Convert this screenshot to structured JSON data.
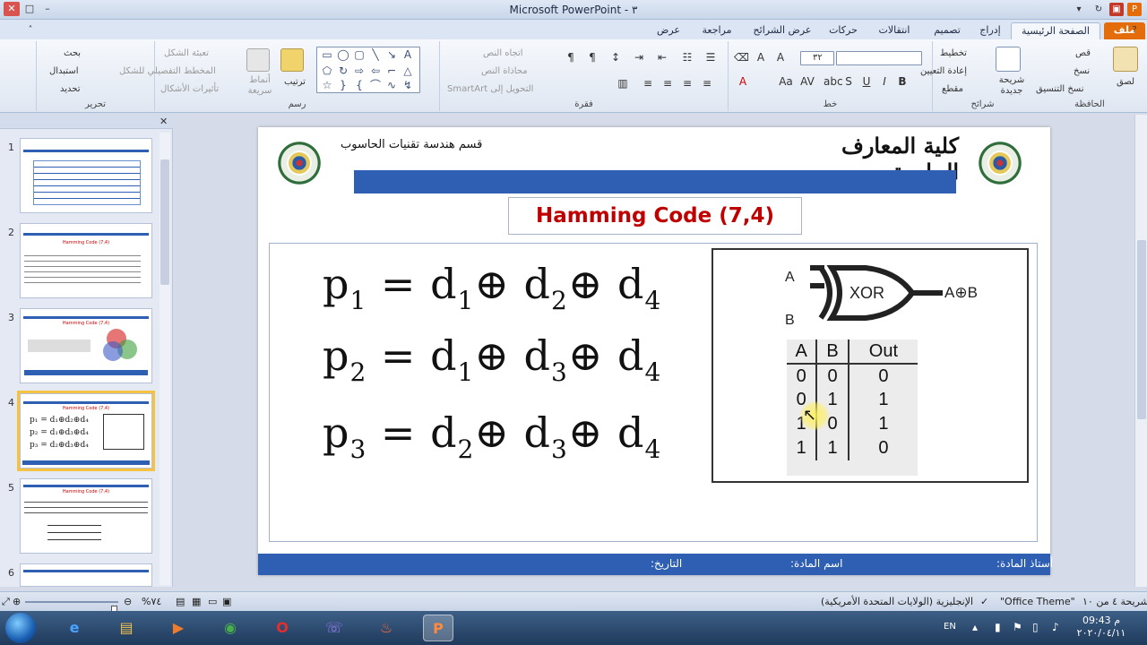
{
  "window": {
    "title": "Microsoft PowerPoint - ٣",
    "controls": {
      "minimize": "–",
      "maximize": "□",
      "close": "✕"
    }
  },
  "tabs": [
    {
      "label": "ملف"
    },
    {
      "label": "الصفحة الرئيسية"
    },
    {
      "label": "إدراج"
    },
    {
      "label": "تصميم"
    },
    {
      "label": "انتقالات"
    },
    {
      "label": "حركات"
    },
    {
      "label": "عرض الشرائح"
    },
    {
      "label": "مراجعة"
    },
    {
      "label": "عرض"
    }
  ],
  "ribbon": {
    "clipboard": {
      "label": "الحافظة",
      "paste": "لصق",
      "cut": "قص",
      "copy": "نسخ",
      "format_painter": "نسخ التنسيق"
    },
    "slides": {
      "label": "شرائح",
      "new_slide": "شريحة جديدة",
      "layout": "تخطيط",
      "reset": "إعادة التعيين",
      "section": "مقطع"
    },
    "font": {
      "label": "خط",
      "size": "٣٢"
    },
    "paragraph": {
      "label": "فقرة",
      "text_direction": "اتجاه النص",
      "align_text": "محاذاة النص",
      "smartart": "التحويل إلى SmartArt"
    },
    "drawing": {
      "label": "رسم",
      "arrange": "ترتيب",
      "quick_styles": "أنماط سريعة",
      "shape_fill": "تعبئة الشكل",
      "shape_outline": "المخطط التفصيلي للشكل",
      "shape_effects": "تأثيرات الأشكال"
    },
    "editing": {
      "label": "تحرير",
      "find": "بحث",
      "replace": "استبدال",
      "select": "تحديد"
    }
  },
  "thumbnails": [
    {
      "num": "1",
      "title": ""
    },
    {
      "num": "2",
      "title": "Hamming Code (7,4)"
    },
    {
      "num": "3",
      "title": "Hamming Code (7,4)"
    },
    {
      "num": "4",
      "title": "Hamming Code (7,4)"
    },
    {
      "num": "5",
      "title": "Hamming Code (7,4)"
    },
    {
      "num": "6",
      "title": ""
    }
  ],
  "slide": {
    "department": "قسم هندسة تقنيات الحاسوب",
    "college": "كلية المعارف الجامعة",
    "title": "Hamming Code (7,4)",
    "equations": [
      {
        "lhs": "p",
        "lhs_sub": "1",
        "terms": [
          {
            "d": "d",
            "s": "1"
          },
          {
            "d": "d",
            "s": "2"
          },
          {
            "d": "d",
            "s": "4"
          }
        ]
      },
      {
        "lhs": "p",
        "lhs_sub": "2",
        "terms": [
          {
            "d": "d",
            "s": "1"
          },
          {
            "d": "d",
            "s": "3"
          },
          {
            "d": "d",
            "s": "4"
          }
        ]
      },
      {
        "lhs": "p",
        "lhs_sub": "3",
        "terms": [
          {
            "d": "d",
            "s": "2"
          },
          {
            "d": "d",
            "s": "3"
          },
          {
            "d": "d",
            "s": "4"
          }
        ]
      }
    ],
    "gate": {
      "input_a": "A",
      "input_b": "B",
      "name": "XOR",
      "output": "A⊕B"
    },
    "truth_table": {
      "headers": [
        "A",
        "B",
        "Out"
      ],
      "rows": [
        [
          "0",
          "0",
          "0"
        ],
        [
          "0",
          "1",
          "1"
        ],
        [
          "1",
          "0",
          "1"
        ],
        [
          "1",
          "1",
          "0"
        ]
      ]
    },
    "footer": {
      "teacher": "أستاذ المادة:",
      "subject": "اسم المادة:",
      "date": "التاريخ:"
    }
  },
  "status": {
    "slide_info": "شريحة ٤ من ١٠",
    "theme": "\"Office Theme\"",
    "language": "الإنجليزية (الولايات المتحدة الأمريكية)",
    "zoom": "%٧٤"
  },
  "taskbar": {
    "lang": "EN",
    "time": "09:43 م",
    "date": "٢٠٢٠/٠٤/١١"
  }
}
